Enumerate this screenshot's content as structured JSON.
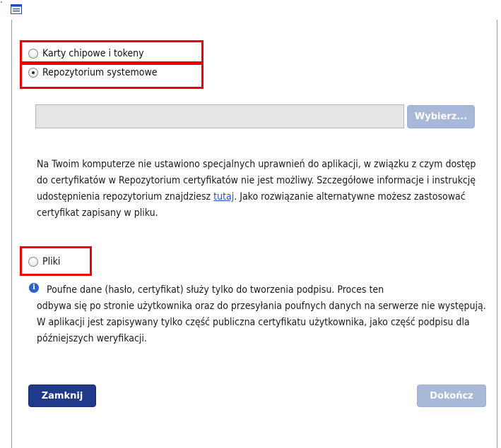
{
  "header": {
    "icon": "form-icon"
  },
  "options": {
    "smartcard_label": "Karty chipowe i tokeny",
    "system_repo_label": "Repozytorium systemowe",
    "files_label": "Pliki",
    "selected": "system_repo"
  },
  "repo": {
    "path_value": "",
    "choose_button": "Wybierz..."
  },
  "message": {
    "before_link": "Na Twoim komputerze nie ustawiono specjalnych uprawnień do aplikacji, w związku z czym dostęp do certyfikatów w Repozytorium certyfikatów nie jest możliwy. Szczegółowe informacje i instrukcję udostępnienia repozytorium znajdziesz ",
    "link": "tutaj",
    "after_link": ". Jako rozwiązanie alternatywne możesz zastosować certyfikat zapisany w pliku."
  },
  "info": {
    "icon": "info-icon",
    "first_line": "Poufne dane (hasło, certyfikat) służy tylko do tworzenia podpisu. Proces ten",
    "rest": "odbywa się po stronie użytkownika oraz do przesyłania poufnych danych na serwerze nie występują. W aplikacji jest zapisywany tylko część publiczna certyfikatu użytkownika, jako część podpisu dla późniejszych weryfikacji."
  },
  "footer": {
    "close_button": "Zamknij",
    "finish_button": "Dokończ"
  },
  "colors": {
    "primary": "#1f3a8a",
    "disabled": "#a8b8d8",
    "highlight": "#ee0000",
    "link": "#1f55c9"
  }
}
